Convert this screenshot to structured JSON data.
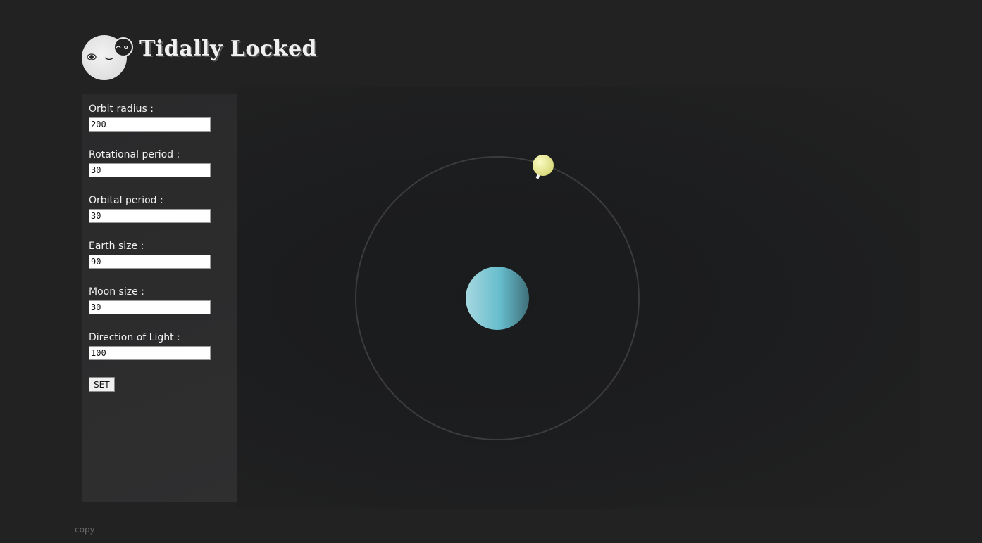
{
  "header": {
    "title": "Tidally Locked",
    "logo_icon": "moon-face-icon"
  },
  "controls": {
    "fields": [
      {
        "label": "Orbit radius :",
        "value": "200"
      },
      {
        "label": "Rotational period :",
        "value": "30"
      },
      {
        "label": "Orbital period :",
        "value": "30"
      },
      {
        "label": "Earth size :",
        "value": "90"
      },
      {
        "label": "Moon size :",
        "value": "30"
      },
      {
        "label": "Direction of Light :",
        "value": "100"
      }
    ],
    "set_label": "SET"
  },
  "footer": {
    "copy": "copy"
  },
  "colors": {
    "background": "#222222",
    "panel": "#2c2c2d",
    "earth": "#6ab8c8",
    "moon": "#f2f29a",
    "orbit": "#3c3c3c"
  }
}
